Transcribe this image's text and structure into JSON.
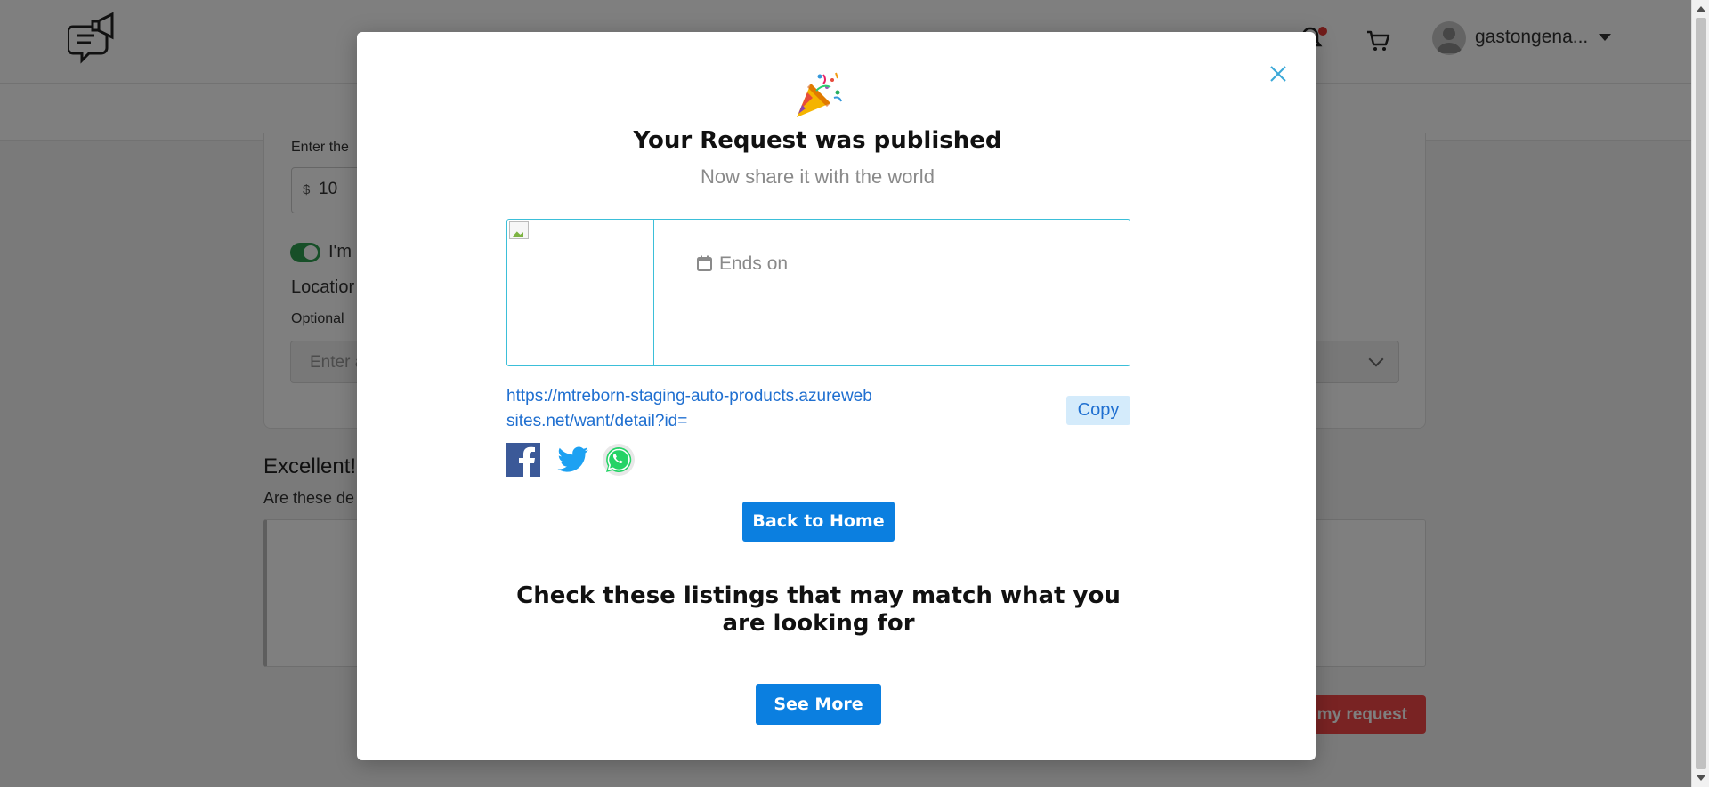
{
  "header": {
    "user_name": "gastongena...",
    "has_notification": true
  },
  "background_form": {
    "price_label_partial": "Enter the",
    "price_symbol": "$",
    "price_value": "10",
    "toggle_label_partial": "I'm",
    "location_label_partial": "Locatior",
    "location_optional": "Optional",
    "location_placeholder_partial": "Enter a",
    "excellent_partial": "Excellent!",
    "details_question_partial": "Are these de",
    "submit_partial": "my request"
  },
  "modal": {
    "title": "Your Request was published",
    "subtitle": "Now share it with the world",
    "preview": {
      "ends_on_label": "Ends on"
    },
    "share_url": "https://mtreborn-staging-auto-products.azurewebsites.net/want/detail?id=",
    "copy_label": "Copy",
    "social": [
      "facebook",
      "twitter",
      "whatsapp"
    ],
    "back_home_label": "Back to Home",
    "listings_title": "Check these listings that may match what you are looking for",
    "see_more_label": "See More"
  },
  "colors": {
    "primary_button": "#0b7fe0",
    "link": "#1f6fd0",
    "preview_border": "#3bbfd9",
    "copy_bg": "#d4ebfb",
    "toggle_on": "#2f9e51",
    "submit_bg": "#f24747",
    "facebook": "#3b5998",
    "twitter": "#1da1f2",
    "whatsapp": "#25d366"
  }
}
